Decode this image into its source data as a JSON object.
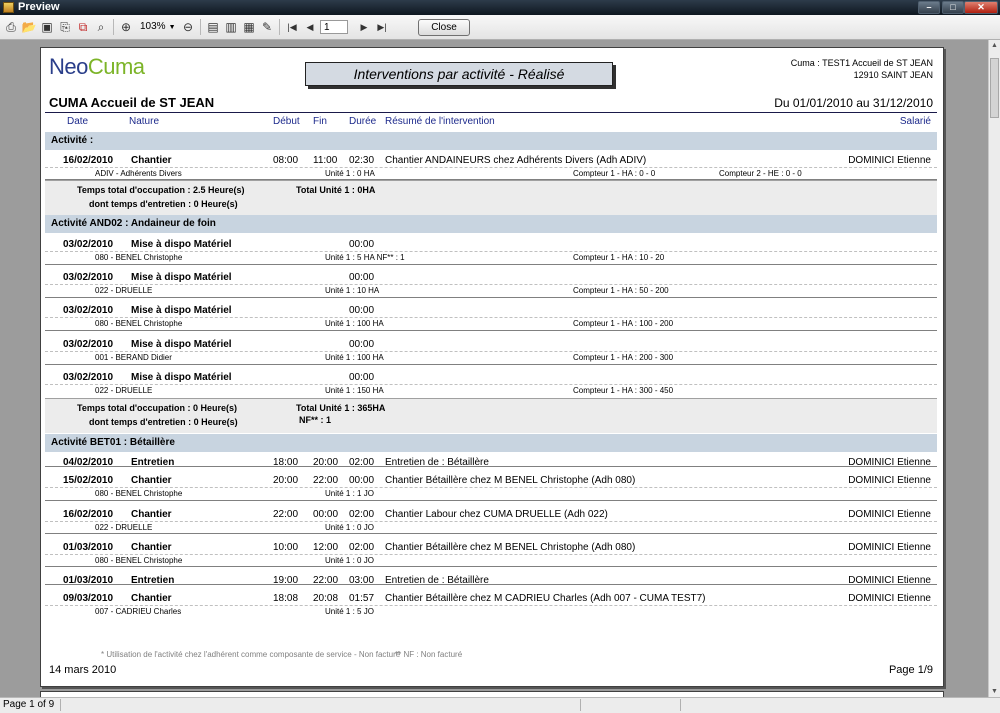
{
  "window": {
    "title": "Preview"
  },
  "toolbar": {
    "zoom": "103%",
    "page_value": "1",
    "close_label": "Close"
  },
  "status": {
    "page": "Page 1 of 9"
  },
  "report": {
    "logo_neo": "Neo",
    "logo_cuma": "Cuma",
    "title": "Interventions par activité - Réalisé",
    "cuma_line1": "Cuma : TEST1 Accueil de  ST JEAN",
    "cuma_line2": "12910  SAINT JEAN",
    "org_name": "CUMA Accueil de ST JEAN",
    "period": "Du 01/01/2010 au 31/12/2010",
    "columns": {
      "date": "Date",
      "nature": "Nature",
      "debut": "Début",
      "fin": "Fin",
      "duree": "Durée",
      "resume": "Résumé de l'intervention",
      "salarie": "Salarié"
    },
    "groups": [
      {
        "header": "Activité  :",
        "rows": [
          {
            "date": "16/02/2010",
            "nature": "Chantier",
            "debut": "08:00",
            "fin": "11:00",
            "duree": "02:30",
            "resume": "Chantier ANDAINEURS chez  Adhérents Divers  (Adh ADIV)",
            "salarie": "DOMINICI Etienne",
            "adh": "ADIV - Adhérents Divers",
            "unite": "Unité 1 : 0 HA",
            "compteur1": "Compteur 1 - HA : 0 - 0",
            "compteur2": "Compteur 2 - HE : 0 - 0"
          }
        ],
        "total": {
          "occupation": "Temps total d'occupation : 2.5 Heure(s)",
          "entretien": "dont temps d'entretien : 0 Heure(s)",
          "unite": "Total Unité 1 : 0HA",
          "nf": ""
        }
      },
      {
        "header": "Activité AND02 : Andaineur de foin",
        "rows": [
          {
            "date": "03/02/2010",
            "nature": "Mise à dispo Matériel",
            "debut": "",
            "fin": "",
            "duree": "00:00",
            "resume": "",
            "salarie": "",
            "adh": "080 - BENEL Christophe",
            "unite": "Unité 1 : 5 HA NF** : 1",
            "compteur1": "Compteur 1 - HA : 10 - 20",
            "compteur2": ""
          },
          {
            "date": "03/02/2010",
            "nature": "Mise à dispo Matériel",
            "debut": "",
            "fin": "",
            "duree": "00:00",
            "resume": "",
            "salarie": "",
            "adh": "022 - DRUELLE",
            "unite": "Unité 1 : 10 HA",
            "compteur1": "Compteur 1 - HA : 50 - 200",
            "compteur2": ""
          },
          {
            "date": "03/02/2010",
            "nature": "Mise à dispo Matériel",
            "debut": "",
            "fin": "",
            "duree": "00:00",
            "resume": "",
            "salarie": "",
            "adh": "080 - BENEL Christophe",
            "unite": "Unité 1 : 100 HA",
            "compteur1": "Compteur 1 - HA : 100 - 200",
            "compteur2": ""
          },
          {
            "date": "03/02/2010",
            "nature": "Mise à dispo Matériel",
            "debut": "",
            "fin": "",
            "duree": "00:00",
            "resume": "",
            "salarie": "",
            "adh": "001 - BERAND Didier",
            "unite": "Unité 1 : 100 HA",
            "compteur1": "Compteur 1 - HA : 200 - 300",
            "compteur2": ""
          },
          {
            "date": "03/02/2010",
            "nature": "Mise à dispo Matériel",
            "debut": "",
            "fin": "",
            "duree": "00:00",
            "resume": "",
            "salarie": "",
            "adh": "022 - DRUELLE",
            "unite": "Unité 1 : 150 HA",
            "compteur1": "Compteur 1 - HA : 300 - 450",
            "compteur2": ""
          }
        ],
        "total": {
          "occupation": "Temps total d'occupation : 0 Heure(s)",
          "entretien": "dont temps d'entretien : 0 Heure(s)",
          "unite": "Total Unité 1 : 365HA",
          "nf": "NF** : 1"
        }
      },
      {
        "header": "Activité BET01 : Bétaillère",
        "rows": [
          {
            "date": "04/02/2010",
            "nature": "Entretien",
            "debut": "18:00",
            "fin": "20:00",
            "duree": "02:00",
            "resume": "Entretien de : Bétaillère",
            "salarie": "DOMINICI Etienne",
            "adh": "",
            "unite": "",
            "compteur1": "",
            "compteur2": ""
          },
          {
            "date": "15/02/2010",
            "nature": "Chantier",
            "debut": "20:00",
            "fin": "22:00",
            "duree": "00:00",
            "resume": "Chantier Bétaillère chez M BENEL Christophe (Adh 080)",
            "salarie": "DOMINICI Etienne",
            "adh": "080 - BENEL Christophe",
            "unite": "Unité 1 : 1 JO",
            "compteur1": "",
            "compteur2": ""
          },
          {
            "date": "16/02/2010",
            "nature": "Chantier",
            "debut": "22:00",
            "fin": "00:00",
            "duree": "02:00",
            "resume": "Chantier Labour chez CUMA DRUELLE  (Adh 022)",
            "salarie": "DOMINICI Etienne",
            "adh": "022 - DRUELLE",
            "unite": "Unité 1 : 0 JO",
            "compteur1": "",
            "compteur2": ""
          },
          {
            "date": "01/03/2010",
            "nature": "Chantier",
            "debut": "10:00",
            "fin": "12:00",
            "duree": "02:00",
            "resume": "Chantier Bétaillère chez M BENEL Christophe (Adh 080)",
            "salarie": "DOMINICI Etienne",
            "adh": "080 - BENEL Christophe",
            "unite": "Unité 1 : 0 JO",
            "compteur1": "",
            "compteur2": ""
          },
          {
            "date": "01/03/2010",
            "nature": "Entretien",
            "debut": "19:00",
            "fin": "22:00",
            "duree": "03:00",
            "resume": "Entretien de : Bétaillère",
            "salarie": "DOMINICI Etienne",
            "adh": "",
            "unite": "",
            "compteur1": "",
            "compteur2": ""
          },
          {
            "date": "09/03/2010",
            "nature": "Chantier",
            "debut": "18:08",
            "fin": "20:08",
            "duree": "01:57",
            "resume": "Chantier Bétaillère chez M CADRIEU Charles (Adh 007 - CUMA TEST7)",
            "salarie": "DOMINICI Etienne",
            "adh": "007 - CADRIEU Charles",
            "unite": "Unité 1 : 5 JO",
            "compteur1": "",
            "compteur2": ""
          }
        ],
        "total": null
      }
    ],
    "footnote1": "* Utilisation de l'activité chez l'adhérent comme composante de service - Non facturé",
    "footnote2": "** NF : Non facturé",
    "print_date": "14 mars 2010",
    "page_label": "Page 1/9"
  }
}
